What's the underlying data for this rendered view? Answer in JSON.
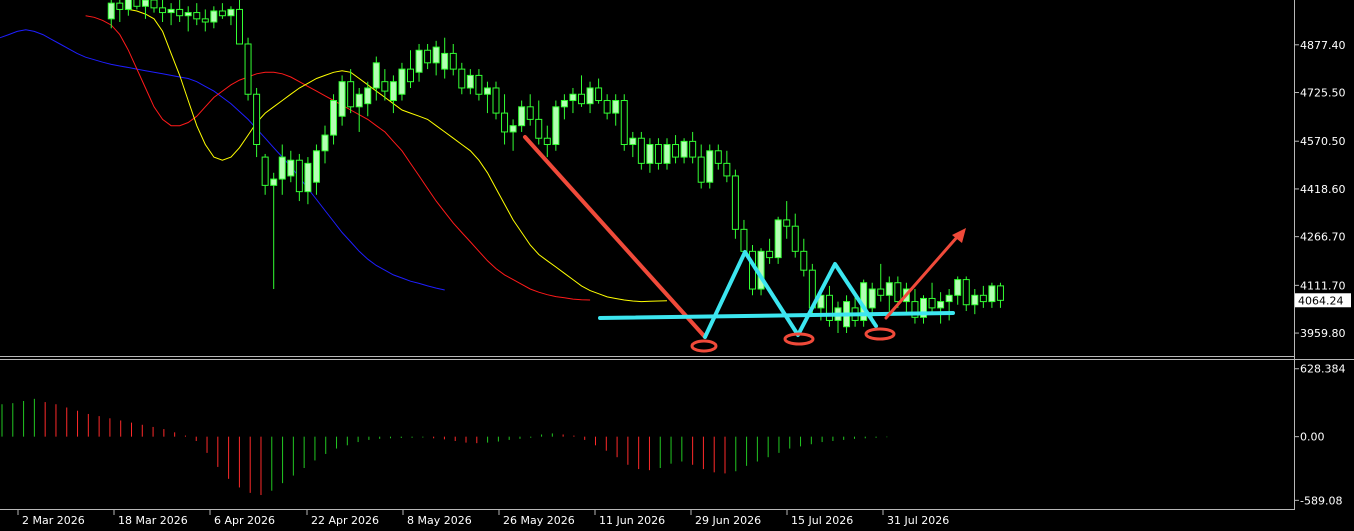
{
  "chart_data": [
    {
      "type": "candlestick",
      "title": "",
      "y_ticks": [
        "4877.40",
        "4725.50",
        "4570.50",
        "4418.60",
        "4266.70",
        "4111.70",
        "3959.80"
      ],
      "ylim": [
        3890,
        5020
      ],
      "current_price": "4064.24",
      "current_price_value": 4064.24,
      "x_ticks": [
        "2 Mar 2026",
        "18 Mar 2026",
        "6 Apr 2026",
        "22 Apr 2026",
        "8 May 2026",
        "26 May 2026",
        "11 Jun 2026",
        "29 Jun 2026",
        "15 Jul 2026",
        "31 Jul 2026"
      ],
      "bar_count": 105,
      "x_tick_bars": [
        2,
        14,
        26,
        38,
        50,
        63,
        75,
        88,
        100,
        112
      ],
      "colors": {
        "bull_body": "#b4ffb4",
        "bear_body": "#000000",
        "wick": "#33ff33",
        "ma_fast": "#ffff00",
        "ma_mid": "#ff1a1a",
        "ma_slow": "#1e1eff",
        "annotation_down": "#f04a3a",
        "annotation_pattern": "#3ce6f0",
        "annotation_circles": "#f04a3a"
      },
      "ohlc": [
        [
          4960,
          5040,
          4930,
          5010
        ],
        [
          5010,
          5060,
          4950,
          4990
        ],
        [
          4990,
          5050,
          4970,
          5030
        ],
        [
          5030,
          5080,
          4990,
          5000
        ],
        [
          5000,
          5040,
          4960,
          5020
        ],
        [
          5020,
          5060,
          4980,
          4995
        ],
        [
          4995,
          5030,
          4950,
          4980
        ],
        [
          4980,
          5010,
          4940,
          4990
        ],
        [
          4990,
          5020,
          4950,
          4970
        ],
        [
          4970,
          5000,
          4920,
          4980
        ],
        [
          4980,
          5010,
          4940,
          4960
        ],
        [
          4960,
          4990,
          4920,
          4950
        ],
        [
          4950,
          5000,
          4930,
          4985
        ],
        [
          4985,
          5010,
          4960,
          4970
        ],
        [
          4970,
          5000,
          4940,
          4990
        ],
        [
          4990,
          5030,
          4960,
          4880
        ],
        [
          4880,
          4900,
          4700,
          4720
        ],
        [
          4720,
          4740,
          4520,
          4560
        ],
        [
          4520,
          4530,
          4400,
          4430
        ],
        [
          4430,
          4470,
          4100,
          4450
        ],
        [
          4450,
          4560,
          4400,
          4520
        ],
        [
          4460,
          4540,
          4440,
          4510
        ],
        [
          4510,
          4530,
          4380,
          4410
        ],
        [
          4410,
          4520,
          4370,
          4500
        ],
        [
          4440,
          4560,
          4400,
          4540
        ],
        [
          4540,
          4620,
          4500,
          4590
        ],
        [
          4590,
          4720,
          4560,
          4700
        ],
        [
          4650,
          4780,
          4620,
          4760
        ],
        [
          4760,
          4800,
          4660,
          4680
        ],
        [
          4680,
          4740,
          4600,
          4720
        ],
        [
          4690,
          4760,
          4650,
          4740
        ],
        [
          4740,
          4840,
          4700,
          4820
        ],
        [
          4760,
          4800,
          4700,
          4730
        ],
        [
          4700,
          4780,
          4660,
          4760
        ],
        [
          4720,
          4820,
          4700,
          4800
        ],
        [
          4800,
          4860,
          4740,
          4760
        ],
        [
          4790,
          4880,
          4760,
          4860
        ],
        [
          4860,
          4880,
          4800,
          4820
        ],
        [
          4820,
          4890,
          4780,
          4870
        ],
        [
          4800,
          4900,
          4770,
          4850
        ],
        [
          4850,
          4880,
          4780,
          4800
        ],
        [
          4800,
          4820,
          4720,
          4740
        ],
        [
          4740,
          4800,
          4720,
          4780
        ],
        [
          4780,
          4800,
          4700,
          4720
        ],
        [
          4720,
          4760,
          4660,
          4740
        ],
        [
          4740,
          4760,
          4640,
          4660
        ],
        [
          4660,
          4720,
          4560,
          4600
        ],
        [
          4600,
          4640,
          4540,
          4620
        ],
        [
          4620,
          4700,
          4600,
          4680
        ],
        [
          4680,
          4720,
          4620,
          4640
        ],
        [
          4640,
          4700,
          4560,
          4580
        ],
        [
          4580,
          4620,
          4520,
          4560
        ],
        [
          4560,
          4700,
          4540,
          4680
        ],
        [
          4680,
          4720,
          4640,
          4700
        ],
        [
          4700,
          4740,
          4660,
          4720
        ],
        [
          4720,
          4780,
          4680,
          4690
        ],
        [
          4690,
          4760,
          4660,
          4740
        ],
        [
          4740,
          4770,
          4690,
          4700
        ],
        [
          4700,
          4720,
          4640,
          4660
        ],
        [
          4660,
          4720,
          4620,
          4700
        ],
        [
          4700,
          4720,
          4540,
          4560
        ],
        [
          4560,
          4600,
          4520,
          4580
        ],
        [
          4580,
          4600,
          4480,
          4500
        ],
        [
          4500,
          4580,
          4470,
          4560
        ],
        [
          4560,
          4580,
          4480,
          4500
        ],
        [
          4500,
          4580,
          4480,
          4560
        ],
        [
          4560,
          4590,
          4500,
          4520
        ],
        [
          4520,
          4580,
          4500,
          4570
        ],
        [
          4570,
          4600,
          4500,
          4520
        ],
        [
          4520,
          4560,
          4420,
          4440
        ],
        [
          4440,
          4560,
          4420,
          4540
        ],
        [
          4540,
          4560,
          4480,
          4500
        ],
        [
          4500,
          4540,
          4440,
          4460
        ],
        [
          4460,
          4480,
          4260,
          4290
        ],
        [
          4290,
          4320,
          4200,
          4220
        ],
        [
          4220,
          4240,
          4080,
          4100
        ],
        [
          4100,
          4230,
          4080,
          4220
        ],
        [
          4220,
          4260,
          4180,
          4200
        ],
        [
          4200,
          4330,
          4180,
          4320
        ],
        [
          4320,
          4380,
          4260,
          4300
        ],
        [
          4300,
          4340,
          4200,
          4220
        ],
        [
          4220,
          4260,
          4140,
          4160
        ],
        [
          4160,
          4180,
          4020,
          4040
        ],
        [
          4040,
          4100,
          4000,
          4080
        ],
        [
          4080,
          4110,
          3980,
          4000
        ],
        [
          4000,
          4060,
          3960,
          4040
        ],
        [
          3980,
          4080,
          3960,
          4060
        ],
        [
          4040,
          4080,
          3980,
          4000
        ],
        [
          4000,
          4130,
          3980,
          4120
        ],
        [
          4040,
          4120,
          3990,
          4100
        ],
        [
          4100,
          4180,
          4060,
          4080
        ],
        [
          4080,
          4140,
          4020,
          4120
        ],
        [
          4120,
          4140,
          4040,
          4060
        ],
        [
          4060,
          4120,
          4020,
          4100
        ],
        [
          4060,
          4100,
          3990,
          4010
        ],
        [
          4010,
          4080,
          3990,
          4070
        ],
        [
          4070,
          4120,
          4020,
          4040
        ],
        [
          4040,
          4090,
          3990,
          4060
        ],
        [
          4060,
          4100,
          4000,
          4080
        ],
        [
          4080,
          4140,
          4050,
          4130
        ],
        [
          4130,
          4140,
          4030,
          4050
        ],
        [
          4050,
          4100,
          4020,
          4080
        ],
        [
          4080,
          4110,
          4040,
          4060
        ],
        [
          4060,
          4120,
          4040,
          4110
        ],
        [
          4110,
          4120,
          4040,
          4064
        ]
      ],
      "ma_fast": [
        4990,
        4985,
        4975,
        4960,
        4920,
        4850,
        4780,
        4700,
        4620,
        4560,
        4520,
        4510,
        4520,
        4550,
        4590,
        4630,
        4660,
        4680,
        4700,
        4720,
        4740,
        4755,
        4770,
        4780,
        4790,
        4795,
        4790,
        4770,
        4750,
        4730,
        4710,
        4690,
        4670,
        4660,
        4650,
        4640,
        4620,
        4600,
        4580,
        4560,
        4540,
        4510,
        4470,
        4420,
        4370,
        4320,
        4280,
        4240,
        4210,
        4190,
        4170,
        4150,
        4130,
        4110,
        4095,
        4085,
        4075,
        4070,
        4065,
        4062,
        4060,
        4061,
        4062,
        4063
      ],
      "ma_fast_start_bar": 40,
      "ma_mid": [
        4970,
        4965,
        4955,
        4940,
        4910,
        4860,
        4800,
        4740,
        4680,
        4640,
        4620,
        4620,
        4630,
        4650,
        4680,
        4710,
        4730,
        4750,
        4765,
        4775,
        4785,
        4790,
        4790,
        4785,
        4775,
        4760,
        4745,
        4730,
        4715,
        4700,
        4685,
        4670,
        4655,
        4640,
        4620,
        4600,
        4570,
        4540,
        4500,
        4460,
        4420,
        4380,
        4345,
        4310,
        4280,
        4250,
        4220,
        4190,
        4165,
        4145,
        4130,
        4115,
        4100,
        4090,
        4082,
        4076,
        4072,
        4068,
        4066,
        4065
      ],
      "ma_mid_start_bar": 44,
      "ma_slow": [
        4880,
        4890,
        4900,
        4910,
        4920,
        4925,
        4920,
        4910,
        4895,
        4880,
        4865,
        4850,
        4838,
        4830,
        4822,
        4815,
        4810,
        4805,
        4800,
        4795,
        4790,
        4785,
        4780,
        4775,
        4770,
        4760,
        4745,
        4730,
        4710,
        4690,
        4665,
        4640,
        4610,
        4580,
        4550,
        4520,
        4490,
        4455,
        4420,
        4385,
        4350,
        4315,
        4280,
        4250,
        4220,
        4195,
        4175,
        4160,
        4145,
        4135,
        4125,
        4118,
        4110,
        4103,
        4097
      ],
      "ma_slow_start_bar": 52
    },
    {
      "type": "histogram",
      "title": "",
      "y_ticks": [
        "628.384",
        "0.00",
        "-589.08"
      ],
      "ylim": [
        -660,
        700
      ],
      "values": [
        300,
        310,
        330,
        350,
        320,
        300,
        270,
        240,
        210,
        190,
        170,
        150,
        130,
        110,
        90,
        70,
        40,
        10,
        -40,
        -150,
        -280,
        -390,
        -470,
        -520,
        -540,
        -500,
        -430,
        -360,
        -290,
        -220,
        -160,
        -110,
        -80,
        -50,
        -30,
        -20,
        -15,
        -12,
        -10,
        -8,
        -15,
        -25,
        -40,
        -55,
        -60,
        -55,
        -45,
        -30,
        -20,
        -10,
        20,
        30,
        20,
        10,
        -30,
        -80,
        -130,
        -190,
        -260,
        -300,
        -310,
        -290,
        -250,
        -230,
        -260,
        -300,
        -330,
        -340,
        -320,
        -270,
        -230,
        -190,
        -150,
        -110,
        -90,
        -70,
        -50,
        -40,
        -30,
        -20,
        -15,
        -10,
        -5
      ],
      "start_bar": 0,
      "bar_step": 1.07
    }
  ]
}
